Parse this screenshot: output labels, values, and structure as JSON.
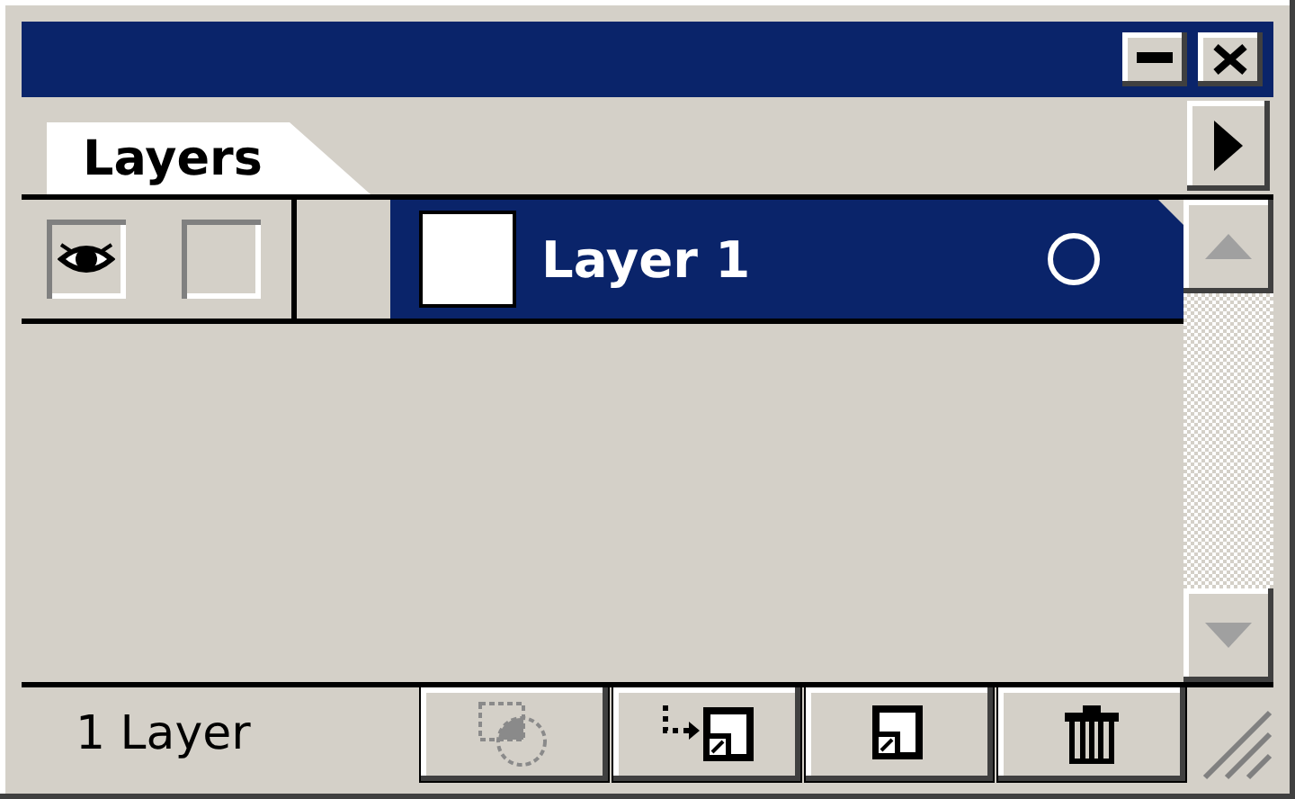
{
  "tabs": [
    {
      "label": "Layers",
      "selected": true
    }
  ],
  "layers": [
    {
      "name": "Layer 1",
      "selected": true,
      "visible": true,
      "locked": false,
      "targeted": false
    }
  ],
  "status_bar": {
    "count": "1 Layer"
  },
  "buttons": [
    {
      "kind": "clip",
      "disabled": true
    },
    {
      "kind": "sublayer",
      "disabled": false
    },
    {
      "kind": "new",
      "disabled": false
    },
    {
      "kind": "trash",
      "disabled": false
    }
  ]
}
